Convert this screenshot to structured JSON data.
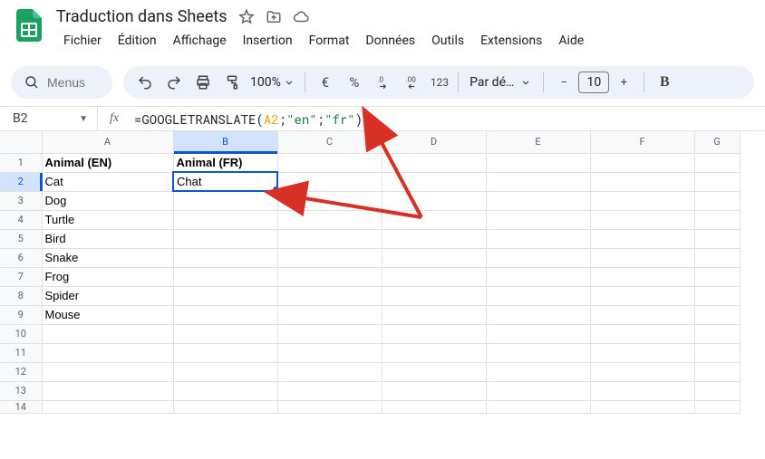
{
  "doc_title": "Traduction dans Sheets",
  "menus": [
    "Fichier",
    "Édition",
    "Affichage",
    "Insertion",
    "Format",
    "Données",
    "Outils",
    "Extensions",
    "Aide"
  ],
  "search_placeholder": "Menus",
  "zoom": "100%",
  "currency_symbol": "€",
  "percent_symbol": "%",
  "numfmt_label": "123",
  "font_name": "Par dé…",
  "font_size": "10",
  "namebox": "B2",
  "fx_label": "fx",
  "formula": {
    "eq": "=",
    "fn": "GOOGLETRANSLATE",
    "ref": "A2",
    "str1": "\"en\"",
    "str2": "\"fr\""
  },
  "columns": [
    "A",
    "B",
    "C",
    "D",
    "E",
    "F",
    "G"
  ],
  "rows": [
    "1",
    "2",
    "3",
    "4",
    "5",
    "6",
    "7",
    "8",
    "9",
    "10",
    "11",
    "12",
    "13",
    "14"
  ],
  "chart_data": {
    "type": "table",
    "selected_cell": "B2",
    "headers": {
      "A1": "Animal (EN)",
      "B1": "Animal (FR)"
    },
    "col_a": [
      "Cat",
      "Dog",
      "Turtle",
      "Bird",
      "Snake",
      "Frog",
      "Spider",
      "Mouse"
    ],
    "col_b": [
      "Chat",
      "",
      "",
      "",
      "",
      "",
      "",
      ""
    ]
  }
}
